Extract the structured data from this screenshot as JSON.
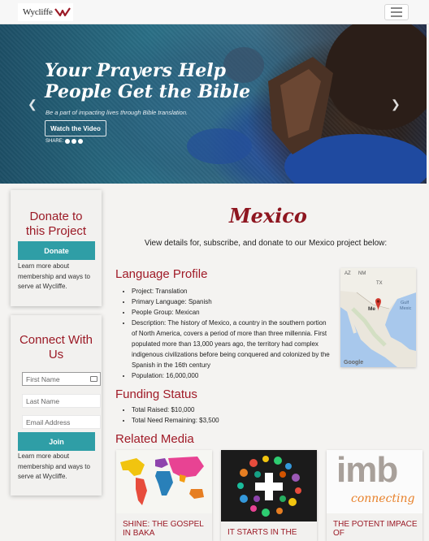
{
  "brand": {
    "logo_text": "Wycliffe",
    "accent": "#9b1a26",
    "teal": "#2f9ea6"
  },
  "hero": {
    "title_line1": "Your Prayers Help",
    "title_line2": "People Get the Bible",
    "subtitle": "Be a part of impacting lives through Bible translation.",
    "button_label": "Watch the Video",
    "share_label": "SHARE:",
    "prev_icon": "chevron-left-icon",
    "next_icon": "chevron-right-icon"
  },
  "donate": {
    "title": "Donate to this Project",
    "button_label": "Donate",
    "note": "Learn more about membership and ways to serve at Wycliffe."
  },
  "connect": {
    "title": "Connect With Us",
    "first_name_placeholder": "First Name",
    "last_name_placeholder": "Last Name",
    "email_placeholder": "Email Address",
    "button_label": "Join",
    "note": "Learn more about membership and ways to serve at Wycliffe."
  },
  "project": {
    "title": "Mexico",
    "intro": "View details for, subscribe, and donate to our Mexico project below:"
  },
  "language_profile": {
    "heading": "Language Profile",
    "items": [
      "Project: Translation",
      "Primary Language: Spanish",
      "People Group: Mexican",
      "Description: The history of Mexico, a country in the southern portion of North America, covers a period of more than three millennia. First populated more than 13,000 years ago, the territory had complex indigenous civilizations before being conquered and colonized by the Spanish in the 16th century",
      "Population: 16,000,000"
    ]
  },
  "map": {
    "labels": [
      "AZ",
      "NM",
      "TX",
      "Me",
      "Gulf",
      "Mexic",
      "Google"
    ]
  },
  "funding": {
    "heading": "Funding Status",
    "items": [
      "Total Raised: $10,000",
      "Total Need Remaining: $3,500"
    ]
  },
  "media": {
    "heading": "Related Media",
    "items": [
      {
        "title": "SHINE: THE GOSPEL IN BAKA"
      },
      {
        "title": "IT STARTS IN THE"
      },
      {
        "title": "THE POTENT IMPACE OF"
      }
    ],
    "imb_text": "imb",
    "imb_sub": "connecting"
  }
}
